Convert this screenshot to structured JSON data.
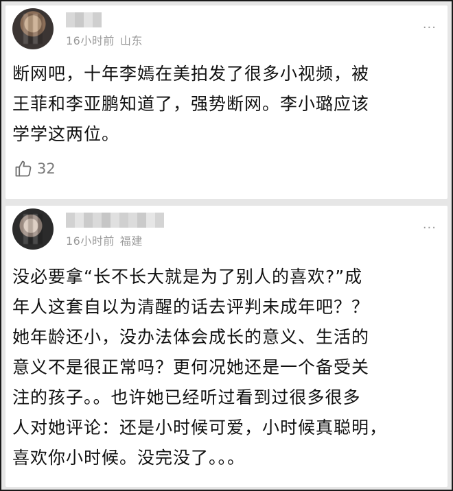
{
  "comments": [
    {
      "time": "16小时前",
      "location": "山东",
      "more": "···",
      "text": "断网吧，十年李嫣在美拍发了很多小视频，被\n王菲和李亚鹏知道了，强势断网。李小璐应该\n学学这两位。",
      "likes": "32"
    },
    {
      "time": "16小时前",
      "location": "福建",
      "more": "···",
      "text": "没必要拿“长不长大就是为了别人的喜欢?”成\n年人这套自以为清醒的话去评判未成年吧？？\n她年龄还小，没办法体会成长的意义、生活的\n意义不是很正常吗？更何况她还是一个备受关\n注的孩子。。也许她已经听过看到过很多很多\n人对她评论：还是小时候可爱，小时候真聪明，\n喜欢你小时候。没完没了。。。"
    }
  ],
  "icons": {
    "like": "thumbs-up-icon",
    "more": "more-dots-icon"
  }
}
